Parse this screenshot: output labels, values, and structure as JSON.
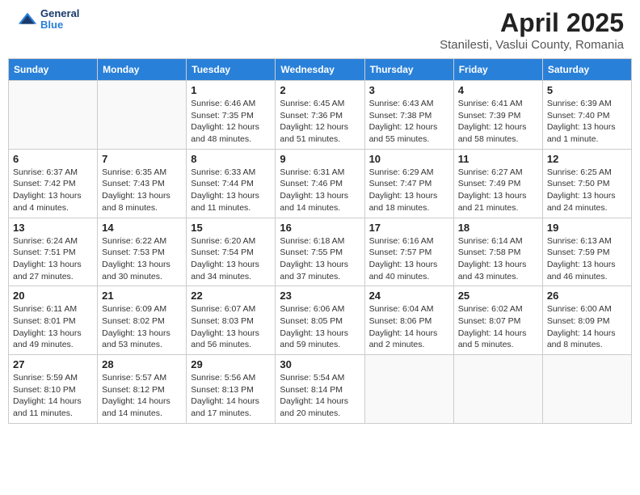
{
  "header": {
    "logo_general": "General",
    "logo_blue": "Blue",
    "title": "April 2025",
    "subtitle": "Stanilesti, Vaslui County, Romania"
  },
  "calendar": {
    "days_of_week": [
      "Sunday",
      "Monday",
      "Tuesday",
      "Wednesday",
      "Thursday",
      "Friday",
      "Saturday"
    ],
    "weeks": [
      [
        {
          "day": "",
          "info": ""
        },
        {
          "day": "",
          "info": ""
        },
        {
          "day": "1",
          "info": "Sunrise: 6:46 AM\nSunset: 7:35 PM\nDaylight: 12 hours and 48 minutes."
        },
        {
          "day": "2",
          "info": "Sunrise: 6:45 AM\nSunset: 7:36 PM\nDaylight: 12 hours and 51 minutes."
        },
        {
          "day": "3",
          "info": "Sunrise: 6:43 AM\nSunset: 7:38 PM\nDaylight: 12 hours and 55 minutes."
        },
        {
          "day": "4",
          "info": "Sunrise: 6:41 AM\nSunset: 7:39 PM\nDaylight: 12 hours and 58 minutes."
        },
        {
          "day": "5",
          "info": "Sunrise: 6:39 AM\nSunset: 7:40 PM\nDaylight: 13 hours and 1 minute."
        }
      ],
      [
        {
          "day": "6",
          "info": "Sunrise: 6:37 AM\nSunset: 7:42 PM\nDaylight: 13 hours and 4 minutes."
        },
        {
          "day": "7",
          "info": "Sunrise: 6:35 AM\nSunset: 7:43 PM\nDaylight: 13 hours and 8 minutes."
        },
        {
          "day": "8",
          "info": "Sunrise: 6:33 AM\nSunset: 7:44 PM\nDaylight: 13 hours and 11 minutes."
        },
        {
          "day": "9",
          "info": "Sunrise: 6:31 AM\nSunset: 7:46 PM\nDaylight: 13 hours and 14 minutes."
        },
        {
          "day": "10",
          "info": "Sunrise: 6:29 AM\nSunset: 7:47 PM\nDaylight: 13 hours and 18 minutes."
        },
        {
          "day": "11",
          "info": "Sunrise: 6:27 AM\nSunset: 7:49 PM\nDaylight: 13 hours and 21 minutes."
        },
        {
          "day": "12",
          "info": "Sunrise: 6:25 AM\nSunset: 7:50 PM\nDaylight: 13 hours and 24 minutes."
        }
      ],
      [
        {
          "day": "13",
          "info": "Sunrise: 6:24 AM\nSunset: 7:51 PM\nDaylight: 13 hours and 27 minutes."
        },
        {
          "day": "14",
          "info": "Sunrise: 6:22 AM\nSunset: 7:53 PM\nDaylight: 13 hours and 30 minutes."
        },
        {
          "day": "15",
          "info": "Sunrise: 6:20 AM\nSunset: 7:54 PM\nDaylight: 13 hours and 34 minutes."
        },
        {
          "day": "16",
          "info": "Sunrise: 6:18 AM\nSunset: 7:55 PM\nDaylight: 13 hours and 37 minutes."
        },
        {
          "day": "17",
          "info": "Sunrise: 6:16 AM\nSunset: 7:57 PM\nDaylight: 13 hours and 40 minutes."
        },
        {
          "day": "18",
          "info": "Sunrise: 6:14 AM\nSunset: 7:58 PM\nDaylight: 13 hours and 43 minutes."
        },
        {
          "day": "19",
          "info": "Sunrise: 6:13 AM\nSunset: 7:59 PM\nDaylight: 13 hours and 46 minutes."
        }
      ],
      [
        {
          "day": "20",
          "info": "Sunrise: 6:11 AM\nSunset: 8:01 PM\nDaylight: 13 hours and 49 minutes."
        },
        {
          "day": "21",
          "info": "Sunrise: 6:09 AM\nSunset: 8:02 PM\nDaylight: 13 hours and 53 minutes."
        },
        {
          "day": "22",
          "info": "Sunrise: 6:07 AM\nSunset: 8:03 PM\nDaylight: 13 hours and 56 minutes."
        },
        {
          "day": "23",
          "info": "Sunrise: 6:06 AM\nSunset: 8:05 PM\nDaylight: 13 hours and 59 minutes."
        },
        {
          "day": "24",
          "info": "Sunrise: 6:04 AM\nSunset: 8:06 PM\nDaylight: 14 hours and 2 minutes."
        },
        {
          "day": "25",
          "info": "Sunrise: 6:02 AM\nSunset: 8:07 PM\nDaylight: 14 hours and 5 minutes."
        },
        {
          "day": "26",
          "info": "Sunrise: 6:00 AM\nSunset: 8:09 PM\nDaylight: 14 hours and 8 minutes."
        }
      ],
      [
        {
          "day": "27",
          "info": "Sunrise: 5:59 AM\nSunset: 8:10 PM\nDaylight: 14 hours and 11 minutes."
        },
        {
          "day": "28",
          "info": "Sunrise: 5:57 AM\nSunset: 8:12 PM\nDaylight: 14 hours and 14 minutes."
        },
        {
          "day": "29",
          "info": "Sunrise: 5:56 AM\nSunset: 8:13 PM\nDaylight: 14 hours and 17 minutes."
        },
        {
          "day": "30",
          "info": "Sunrise: 5:54 AM\nSunset: 8:14 PM\nDaylight: 14 hours and 20 minutes."
        },
        {
          "day": "",
          "info": ""
        },
        {
          "day": "",
          "info": ""
        },
        {
          "day": "",
          "info": ""
        }
      ]
    ]
  }
}
